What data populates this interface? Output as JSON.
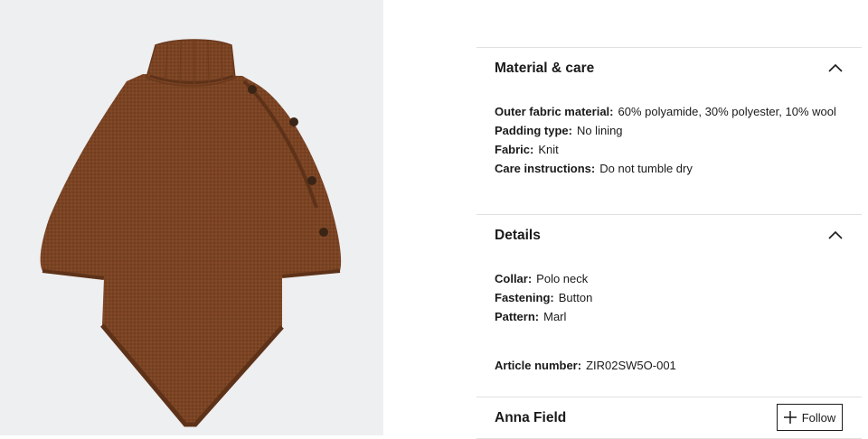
{
  "product": {
    "image_alt": "Brown knit poncho with turtleneck and side buttons",
    "colors": {
      "image_bg": "#eeeff1",
      "knit": "#7a4423",
      "knit_dark": "#5e3219",
      "button": "#3a2416"
    }
  },
  "material": {
    "title": "Material & care",
    "expanded": true,
    "rows": [
      {
        "key": "Outer fabric material:",
        "value": "60% polyamide, 30% polyester, 10% wool"
      },
      {
        "key": "Padding type:",
        "value": "No lining"
      },
      {
        "key": "Fabric:",
        "value": "Knit"
      },
      {
        "key": "Care instructions:",
        "value": "Do not tumble dry"
      }
    ]
  },
  "details": {
    "title": "Details",
    "expanded": true,
    "rows": [
      {
        "key": "Collar:",
        "value": "Polo neck"
      },
      {
        "key": "Fastening:",
        "value": "Button"
      },
      {
        "key": "Pattern:",
        "value": "Marl"
      }
    ],
    "article": {
      "key": "Article number:",
      "value": "ZIR02SW5O-001"
    }
  },
  "brand": {
    "name": "Anna Field",
    "follow_label": "Follow"
  }
}
